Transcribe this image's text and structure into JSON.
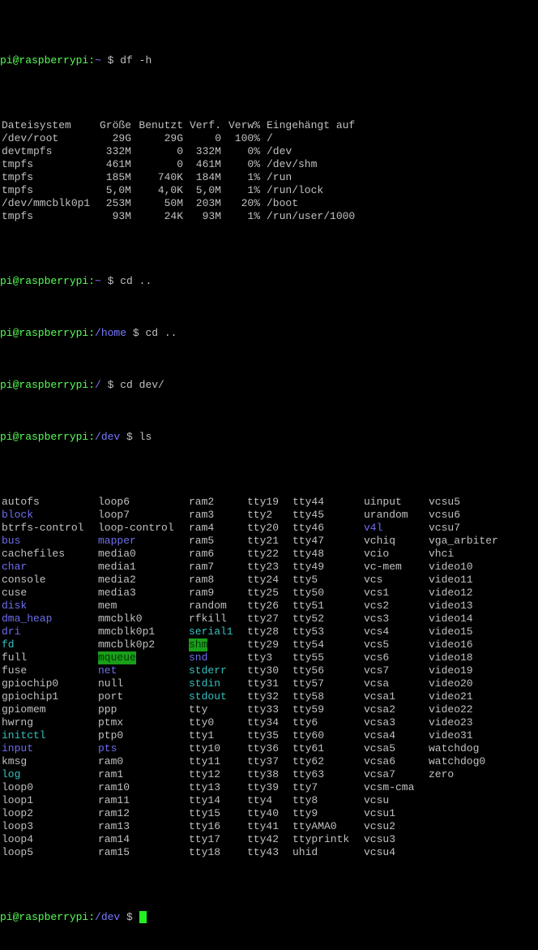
{
  "prompt": {
    "user_host": "pi@raspberrypi",
    "colon": ":",
    "dollar": " $ "
  },
  "commands": {
    "df": "df -h",
    "cd1": "cd ..",
    "cd2": "cd ..",
    "cd3": "cd dev/",
    "ls": "ls"
  },
  "paths": {
    "home_user": "~",
    "home": "/home",
    "root": "/",
    "dev": "/dev"
  },
  "df_table": {
    "headers": [
      "Dateisystem",
      "Größe",
      "Benutzt",
      "Verf.",
      "Verw%",
      "Eingehängt auf"
    ],
    "rows": [
      [
        "/dev/root",
        "29G",
        "29G",
        "0",
        "100%",
        "/"
      ],
      [
        "devtmpfs",
        "332M",
        "0",
        "332M",
        "0%",
        "/dev"
      ],
      [
        "tmpfs",
        "461M",
        "0",
        "461M",
        "0%",
        "/dev/shm"
      ],
      [
        "tmpfs",
        "185M",
        "740K",
        "184M",
        "1%",
        "/run"
      ],
      [
        "tmpfs",
        "5,0M",
        "4,0K",
        "5,0M",
        "1%",
        "/run/lock"
      ],
      [
        "/dev/mmcblk0p1",
        "253M",
        "50M",
        "203M",
        "20%",
        "/boot"
      ],
      [
        "tmpfs",
        "93M",
        "24K",
        "93M",
        "1%",
        "/run/user/1000"
      ]
    ]
  },
  "ls_rows": [
    [
      [
        "autofs",
        "dev"
      ],
      [
        "loop6",
        "dev"
      ],
      [
        "ram2",
        "dev"
      ],
      [
        "tty19",
        "dev"
      ],
      [
        "tty44",
        "dev"
      ],
      [
        "uinput",
        "dev"
      ],
      [
        "vcsu5",
        "dev"
      ]
    ],
    [
      [
        "block",
        "dir"
      ],
      [
        "loop7",
        "dev"
      ],
      [
        "ram3",
        "dev"
      ],
      [
        "tty2",
        "dev"
      ],
      [
        "tty45",
        "dev"
      ],
      [
        "urandom",
        "dev"
      ],
      [
        "vcsu6",
        "dev"
      ]
    ],
    [
      [
        "btrfs-control",
        "dev"
      ],
      [
        "loop-control",
        "dev"
      ],
      [
        "ram4",
        "dev"
      ],
      [
        "tty20",
        "dev"
      ],
      [
        "tty46",
        "dev"
      ],
      [
        "v4l",
        "dir"
      ],
      [
        "vcsu7",
        "dev"
      ]
    ],
    [
      [
        "bus",
        "dir"
      ],
      [
        "mapper",
        "dir"
      ],
      [
        "ram5",
        "dev"
      ],
      [
        "tty21",
        "dev"
      ],
      [
        "tty47",
        "dev"
      ],
      [
        "vchiq",
        "dev"
      ],
      [
        "vga_arbiter",
        "dev"
      ]
    ],
    [
      [
        "cachefiles",
        "dev"
      ],
      [
        "media0",
        "dev"
      ],
      [
        "ram6",
        "dev"
      ],
      [
        "tty22",
        "dev"
      ],
      [
        "tty48",
        "dev"
      ],
      [
        "vcio",
        "dev"
      ],
      [
        "vhci",
        "dev"
      ]
    ],
    [
      [
        "char",
        "dir"
      ],
      [
        "media1",
        "dev"
      ],
      [
        "ram7",
        "dev"
      ],
      [
        "tty23",
        "dev"
      ],
      [
        "tty49",
        "dev"
      ],
      [
        "vc-mem",
        "dev"
      ],
      [
        "video10",
        "dev"
      ]
    ],
    [
      [
        "console",
        "dev"
      ],
      [
        "media2",
        "dev"
      ],
      [
        "ram8",
        "dev"
      ],
      [
        "tty24",
        "dev"
      ],
      [
        "tty5",
        "dev"
      ],
      [
        "vcs",
        "dev"
      ],
      [
        "video11",
        "dev"
      ]
    ],
    [
      [
        "cuse",
        "dev"
      ],
      [
        "media3",
        "dev"
      ],
      [
        "ram9",
        "dev"
      ],
      [
        "tty25",
        "dev"
      ],
      [
        "tty50",
        "dev"
      ],
      [
        "vcs1",
        "dev"
      ],
      [
        "video12",
        "dev"
      ]
    ],
    [
      [
        "disk",
        "dir"
      ],
      [
        "mem",
        "dev"
      ],
      [
        "random",
        "dev"
      ],
      [
        "tty26",
        "dev"
      ],
      [
        "tty51",
        "dev"
      ],
      [
        "vcs2",
        "dev"
      ],
      [
        "video13",
        "dev"
      ]
    ],
    [
      [
        "dma_heap",
        "dir"
      ],
      [
        "mmcblk0",
        "dev"
      ],
      [
        "rfkill",
        "dev"
      ],
      [
        "tty27",
        "dev"
      ],
      [
        "tty52",
        "dev"
      ],
      [
        "vcs3",
        "dev"
      ],
      [
        "video14",
        "dev"
      ]
    ],
    [
      [
        "dri",
        "dir"
      ],
      [
        "mmcblk0p1",
        "dev"
      ],
      [
        "serial1",
        "link"
      ],
      [
        "tty28",
        "dev"
      ],
      [
        "tty53",
        "dev"
      ],
      [
        "vcs4",
        "dev"
      ],
      [
        "video15",
        "dev"
      ]
    ],
    [
      [
        "fd",
        "link"
      ],
      [
        "mmcblk0p2",
        "dev"
      ],
      [
        "shm",
        "hl"
      ],
      [
        "tty29",
        "dev"
      ],
      [
        "tty54",
        "dev"
      ],
      [
        "vcs5",
        "dev"
      ],
      [
        "video16",
        "dev"
      ]
    ],
    [
      [
        "full",
        "dev"
      ],
      [
        "mqueue",
        "hl"
      ],
      [
        "snd",
        "dir"
      ],
      [
        "tty3",
        "dev"
      ],
      [
        "tty55",
        "dev"
      ],
      [
        "vcs6",
        "dev"
      ],
      [
        "video18",
        "dev"
      ]
    ],
    [
      [
        "fuse",
        "dev"
      ],
      [
        "net",
        "dir"
      ],
      [
        "stderr",
        "link"
      ],
      [
        "tty30",
        "dev"
      ],
      [
        "tty56",
        "dev"
      ],
      [
        "vcs7",
        "dev"
      ],
      [
        "video19",
        "dev"
      ]
    ],
    [
      [
        "gpiochip0",
        "dev"
      ],
      [
        "null",
        "dev"
      ],
      [
        "stdin",
        "link"
      ],
      [
        "tty31",
        "dev"
      ],
      [
        "tty57",
        "dev"
      ],
      [
        "vcsa",
        "dev"
      ],
      [
        "video20",
        "dev"
      ]
    ],
    [
      [
        "gpiochip1",
        "dev"
      ],
      [
        "port",
        "dev"
      ],
      [
        "stdout",
        "link"
      ],
      [
        "tty32",
        "dev"
      ],
      [
        "tty58",
        "dev"
      ],
      [
        "vcsa1",
        "dev"
      ],
      [
        "video21",
        "dev"
      ]
    ],
    [
      [
        "gpiomem",
        "dev"
      ],
      [
        "ppp",
        "dev"
      ],
      [
        "tty",
        "dev"
      ],
      [
        "tty33",
        "dev"
      ],
      [
        "tty59",
        "dev"
      ],
      [
        "vcsa2",
        "dev"
      ],
      [
        "video22",
        "dev"
      ]
    ],
    [
      [
        "hwrng",
        "dev"
      ],
      [
        "ptmx",
        "dev"
      ],
      [
        "tty0",
        "dev"
      ],
      [
        "tty34",
        "dev"
      ],
      [
        "tty6",
        "dev"
      ],
      [
        "vcsa3",
        "dev"
      ],
      [
        "video23",
        "dev"
      ]
    ],
    [
      [
        "initctl",
        "link"
      ],
      [
        "ptp0",
        "dev"
      ],
      [
        "tty1",
        "dev"
      ],
      [
        "tty35",
        "dev"
      ],
      [
        "tty60",
        "dev"
      ],
      [
        "vcsa4",
        "dev"
      ],
      [
        "video31",
        "dev"
      ]
    ],
    [
      [
        "input",
        "dir"
      ],
      [
        "pts",
        "dir"
      ],
      [
        "tty10",
        "dev"
      ],
      [
        "tty36",
        "dev"
      ],
      [
        "tty61",
        "dev"
      ],
      [
        "vcsa5",
        "dev"
      ],
      [
        "watchdog",
        "dev"
      ]
    ],
    [
      [
        "kmsg",
        "dev"
      ],
      [
        "ram0",
        "dev"
      ],
      [
        "tty11",
        "dev"
      ],
      [
        "tty37",
        "dev"
      ],
      [
        "tty62",
        "dev"
      ],
      [
        "vcsa6",
        "dev"
      ],
      [
        "watchdog0",
        "dev"
      ]
    ],
    [
      [
        "log",
        "link"
      ],
      [
        "ram1",
        "dev"
      ],
      [
        "tty12",
        "dev"
      ],
      [
        "tty38",
        "dev"
      ],
      [
        "tty63",
        "dev"
      ],
      [
        "vcsa7",
        "dev"
      ],
      [
        "zero",
        "dev"
      ]
    ],
    [
      [
        "loop0",
        "dev"
      ],
      [
        "ram10",
        "dev"
      ],
      [
        "tty13",
        "dev"
      ],
      [
        "tty39",
        "dev"
      ],
      [
        "tty7",
        "dev"
      ],
      [
        "vcsm-cma",
        "dev"
      ],
      null
    ],
    [
      [
        "loop1",
        "dev"
      ],
      [
        "ram11",
        "dev"
      ],
      [
        "tty14",
        "dev"
      ],
      [
        "tty4",
        "dev"
      ],
      [
        "tty8",
        "dev"
      ],
      [
        "vcsu",
        "dev"
      ],
      null
    ],
    [
      [
        "loop2",
        "dev"
      ],
      [
        "ram12",
        "dev"
      ],
      [
        "tty15",
        "dev"
      ],
      [
        "tty40",
        "dev"
      ],
      [
        "tty9",
        "dev"
      ],
      [
        "vcsu1",
        "dev"
      ],
      null
    ],
    [
      [
        "loop3",
        "dev"
      ],
      [
        "ram13",
        "dev"
      ],
      [
        "tty16",
        "dev"
      ],
      [
        "tty41",
        "dev"
      ],
      [
        "ttyAMA0",
        "dev"
      ],
      [
        "vcsu2",
        "dev"
      ],
      null
    ],
    [
      [
        "loop4",
        "dev"
      ],
      [
        "ram14",
        "dev"
      ],
      [
        "tty17",
        "dev"
      ],
      [
        "tty42",
        "dev"
      ],
      [
        "ttyprintk",
        "dev"
      ],
      [
        "vcsu3",
        "dev"
      ],
      null
    ],
    [
      [
        "loop5",
        "dev"
      ],
      [
        "ram15",
        "dev"
      ],
      [
        "tty18",
        "dev"
      ],
      [
        "tty43",
        "dev"
      ],
      [
        "uhid",
        "dev"
      ],
      [
        "vcsu4",
        "dev"
      ],
      null
    ]
  ],
  "colors": {
    "background": "#000000",
    "text": "#c0c0c0",
    "prompt_user": "#55ff55",
    "prompt_path": "#7878ff",
    "directory": "#6e6ef0",
    "symlink": "#35c0c0",
    "highlight_bg": "#1a9e1a",
    "cursor": "#22ee22"
  },
  "icons": {
    "cursor": "block-cursor-icon"
  }
}
